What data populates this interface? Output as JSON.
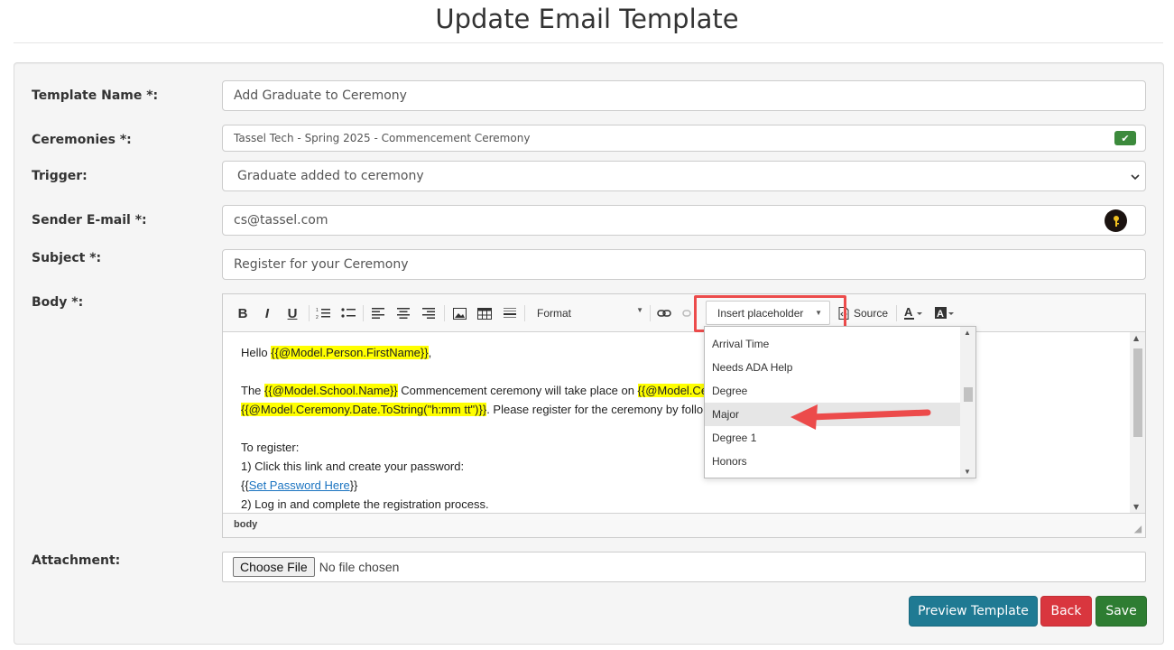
{
  "page": {
    "title": "Update Email Template"
  },
  "form": {
    "template_name": {
      "label": "Template Name *:",
      "value": "Add Graduate to Ceremony"
    },
    "ceremonies": {
      "label": "Ceremonies *:",
      "value": "Tassel Tech - Spring 2025 - Commencement Ceremony"
    },
    "trigger": {
      "label": "Trigger:",
      "value": "Graduate added to ceremony"
    },
    "sender_email": {
      "label": "Sender E-mail *:",
      "value": "cs@tassel.com"
    },
    "subject": {
      "label": "Subject *:",
      "value": "Register for your Ceremony"
    },
    "body": {
      "label": "Body *:"
    },
    "attachment": {
      "label": "Attachment:",
      "button": "Choose File",
      "status": "No file chosen"
    }
  },
  "editor": {
    "toolbar": {
      "bold": "B",
      "italic": "I",
      "underline": "U",
      "format": "Format",
      "insert_placeholder": "Insert placeholder",
      "source": "Source"
    },
    "content": {
      "line1_prefix": "Hello ",
      "line1_ph": "{{@Model.Person.FirstName}}",
      "line1_suffix": ",",
      "line2_prefix": "The ",
      "line2_ph1": "{{@Model.School.Name}}",
      "line2_mid": " Commencement ceremony will take place on ",
      "line2_ph2": "{{@Model.Ce",
      "line3_ph": "{{@Model.Ceremony.Date.ToString(\"h:mm tt\")}}",
      "line3_suffix": ".  Please register for the ceremony by follo",
      "line4": "To register:",
      "line5": "1) Click this link and create your password:",
      "line6_open": "{{",
      "line6_link": "Set Password Here",
      "line6_close": "}}",
      "line7": "2) Log in and complete the registration process."
    },
    "status_path": "body"
  },
  "placeholder_dropdown": {
    "items": [
      "Arrival Time",
      "Needs ADA Help",
      "Degree",
      "Major",
      "Degree 1",
      "Honors"
    ],
    "selected": "Major"
  },
  "actions": {
    "preview": "Preview Template",
    "back": "Back",
    "save": "Save"
  },
  "colors": {
    "highlight": "#ffff00",
    "annotation": "#ec4b4b",
    "preview": "#1f7a93",
    "back": "#d9363e",
    "save": "#2e7d32"
  }
}
